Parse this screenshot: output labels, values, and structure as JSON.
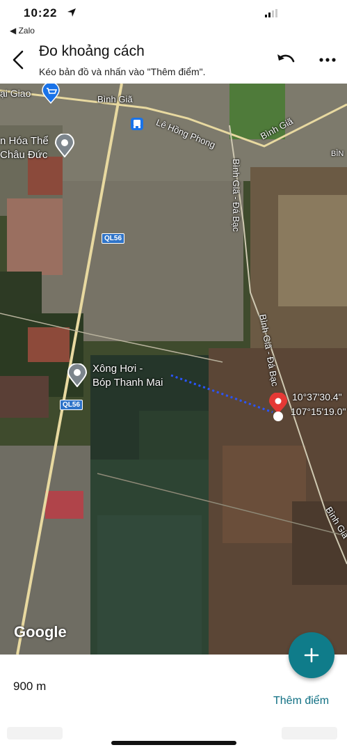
{
  "status_bar": {
    "time": "10:22"
  },
  "nav": {
    "back_app": "◀ Zalo"
  },
  "header": {
    "title": "Đo khoảng cách",
    "subtitle": "Kéo bản đồ và nhấn vào \"Thêm điểm\"."
  },
  "map": {
    "labels": {
      "ngai_giao": "ại Giao",
      "binh_gia_top": "Bình Giã",
      "le_hong_phong": "Lê Hồng Phong",
      "binh_gia_right": "Bình Giã",
      "binh_edge": "BÌN",
      "binh_gia_da_bac_1": "Bình Giã - Đá Bạc",
      "binh_gia_da_bac_2": "Bình Giã - Đá Bạc",
      "binh_gia_bottom": "Bình Giã",
      "poi_van_hoa_line1": "n Hóa Thể",
      "poi_van_hoa_line2": "Châu Đức",
      "poi_xong_hoi_line1": "Xông Hơi -",
      "poi_xong_hoi_line2": "Bóp Thanh Mai",
      "ql56_a": "QL56",
      "ql56_b": "QL56",
      "google": "Google"
    },
    "coordinates": {
      "lat": "10°37'30.4\"",
      "lng": "107°15'19.0\""
    }
  },
  "measurement": {
    "distance": "900 m",
    "add_point_label": "Thêm điểm"
  },
  "colors": {
    "accent": "#0f7c8a",
    "link": "#0f6f83",
    "pin": "#e53935",
    "road": "#e8d9a0"
  }
}
